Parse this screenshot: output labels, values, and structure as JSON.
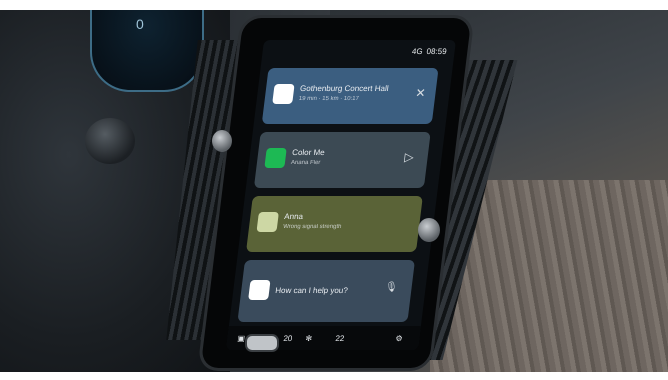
{
  "status": {
    "signal": "4G",
    "time": "08:59"
  },
  "cards": {
    "maps": {
      "title": "Gothenburg Concert Hall",
      "subtitle": "19 min · 15 km · 10:17"
    },
    "music": {
      "title": "Color Me",
      "subtitle": "Ariana Fler"
    },
    "phone": {
      "title": "Anna",
      "subtitle": "Wrong signal strength"
    },
    "assistant": {
      "title": "How can I help you?"
    }
  },
  "bottom": {
    "temp_left": "20",
    "temp_right": "22"
  },
  "dash": {
    "gauge_value": "0"
  },
  "colors": {
    "maps_card": "#3b5e80",
    "music_card": "#3c4a54",
    "phone_card": "#5a6337",
    "assistant_card": "#3a4b5c"
  }
}
